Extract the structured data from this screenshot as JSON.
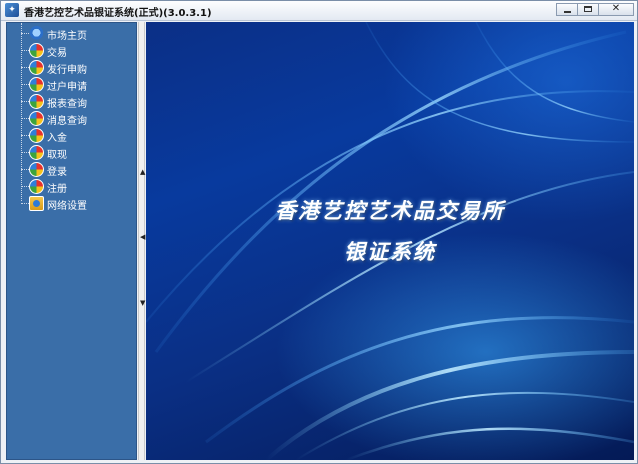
{
  "window": {
    "title": "香港艺控艺术品银证系统(正式)(3.0.3.1)",
    "app_icon_glyph": "✦"
  },
  "sidebar": {
    "items": [
      {
        "label": "市场主页",
        "icon": "home-globe-icon"
      },
      {
        "label": "交易",
        "icon": "color-pie-icon"
      },
      {
        "label": "发行申购",
        "icon": "color-pie-icon"
      },
      {
        "label": "过户申请",
        "icon": "color-pie-icon"
      },
      {
        "label": "报表查询",
        "icon": "color-pie-icon"
      },
      {
        "label": "消息查询",
        "icon": "color-pie-icon"
      },
      {
        "label": "入金",
        "icon": "color-pie-icon"
      },
      {
        "label": "取现",
        "icon": "color-pie-icon"
      },
      {
        "label": "登录",
        "icon": "color-pie-icon"
      },
      {
        "label": "注册",
        "icon": "color-pie-icon"
      },
      {
        "label": "网络设置",
        "icon": "network-settings-icon"
      }
    ]
  },
  "main": {
    "headline_line1": "香港艺控艺术品交易所",
    "headline_line2": "银证系统"
  },
  "colors": {
    "sidebar_bg": "#3a6ea8",
    "main_bg_dark": "#041a56",
    "main_bg_light": "#0a3ea8"
  }
}
